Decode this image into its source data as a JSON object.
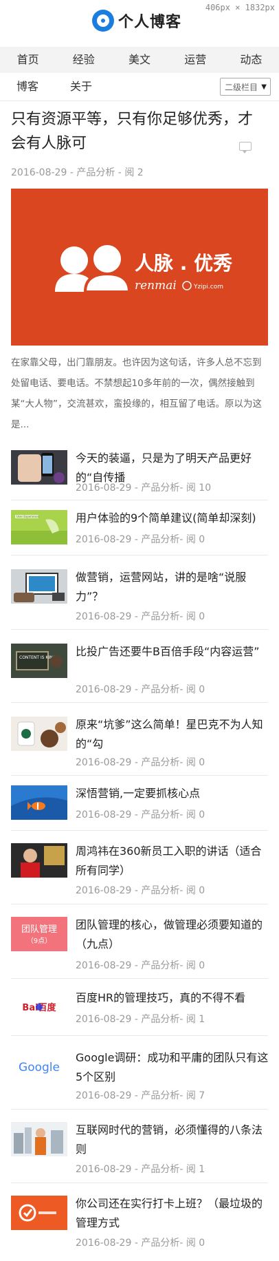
{
  "header": {
    "logo_text": "个人博客",
    "dimension_label": "406px × 1832px"
  },
  "nav": {
    "primary": [
      "首页",
      "经验",
      "美文",
      "运营",
      "动态"
    ],
    "secondary": [
      "博客",
      "关于"
    ],
    "select_value": "二级栏目"
  },
  "featured": {
    "title": "只有资源平等，只有你足够优秀，才会有人脉可",
    "date": "2016-08-29",
    "category": "产品分析",
    "views": "阅 2",
    "image_text_main": "人脉 . 优秀",
    "image_text_sub": "renmai",
    "image_text_site": "Yzipi.com",
    "summary": "在家靠父母，出门靠朋友。也许因为这句话，许多人总不忘到处留电话、要电话。不禁想起10多年前的一次，偶然接触到某“大人物”，交流甚欢，蛮投缘的，相互留了电话。原以为这是..."
  },
  "articles": [
    {
      "title": "今天的装逼，只是为了明天产品更好的“自传播",
      "date": "2016-08-29",
      "category": "产品分析",
      "views": "阅 10"
    },
    {
      "title": "用户体验的9个简单建议(简单却深刻)",
      "date": "2016-08-29",
      "category": "产品分析",
      "views": "阅 0",
      "thumb_label": "User Experience"
    },
    {
      "title": "做营销，运营网站，讲的是啥“说服力”？",
      "date": "2016-08-29",
      "category": "产品分析",
      "views": "阅 0"
    },
    {
      "title": "比投广告还要牛B百倍手段“内容运营”",
      "date": "2016-08-29",
      "category": "产品分析",
      "views": "阅 0",
      "thumb_label": "CONTENT IS KING"
    },
    {
      "title": "原来“坑爹”这么简单！星巴克不为人知的“勾",
      "date": "2016-08-29",
      "category": "产品分析",
      "views": "阅 0"
    },
    {
      "title": "深悟营销,一定要抓核心点",
      "date": "2016-08-29",
      "category": "产品分析",
      "views": "阅 0"
    },
    {
      "title": "周鸿祎在360新员工入职的讲话（适合所有同学）",
      "date": "2016-08-29",
      "category": "产品分析",
      "views": "阅 0"
    },
    {
      "title": "团队管理的核心，做管理必须要知道的（九点）",
      "date": "2016-08-29",
      "category": "产品分析",
      "views": "阅 0",
      "thumb_label": "团队管理",
      "thumb_sub": "（9点）"
    },
    {
      "title": "百度HR的管理技巧，真的不得不看",
      "date": "2016-08-29",
      "category": "产品分析",
      "views": "阅 1",
      "thumb_label": "Bai百度"
    },
    {
      "title": "Google调研：成功和平庸的团队只有这5个区别",
      "date": "2016-08-29",
      "category": "产品分析",
      "views": "阅 7",
      "thumb_label": "Google"
    },
    {
      "title": "互联网时代的营销，必须懂得的八条法则",
      "date": "2016-08-29",
      "category": "产品分析",
      "views": "阅 1"
    },
    {
      "title": "你公司还在实行打卡上班？（最垃圾的管理方式",
      "date": "2016-08-29",
      "category": "产品分析",
      "views": "阅 0"
    }
  ],
  "colors": {
    "featured_bg": "#d9461f",
    "accent_blue": "#1a7de0",
    "nav_bg": "#f3f3f3"
  }
}
